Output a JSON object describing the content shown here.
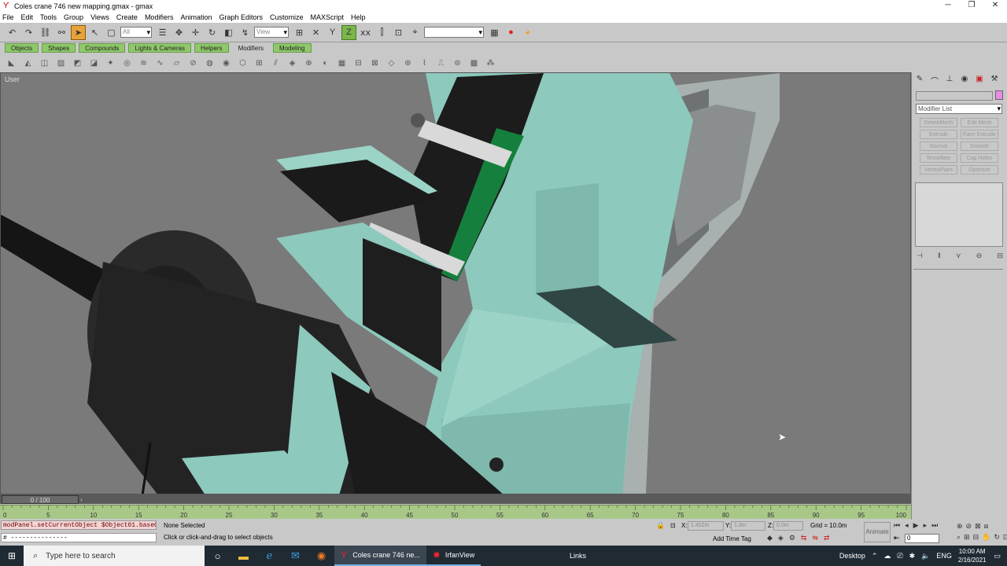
{
  "window": {
    "title": "Coles crane 746 new mapping.gmax - gmax",
    "minimize": "─",
    "maximize": "❐",
    "close": "✕"
  },
  "menu": [
    "File",
    "Edit",
    "Tools",
    "Group",
    "Views",
    "Create",
    "Modifiers",
    "Animation",
    "Graph Editors",
    "Customize",
    "MAXScript",
    "Help"
  ],
  "toolbar": {
    "selection_filter": "All",
    "ref_coord": "View",
    "named_selection": ""
  },
  "tabs": [
    "Objects",
    "Shapes",
    "Compounds",
    "Lights & Cameras",
    "Helpers",
    "Modifiers",
    "Modeling"
  ],
  "selected_tab": "Modifiers",
  "viewport": {
    "label": "User"
  },
  "command_panel": {
    "modifier_list": "Modifier List",
    "modifier_buttons": [
      "DeleteMesh",
      "Edit Mesh",
      "Extrude",
      "Face Extrude",
      "Normal",
      "Smooth",
      "Tessellate",
      "Cap Holes",
      "VertexPaint",
      "Optimize"
    ]
  },
  "timeline": {
    "slider": "0 / 100",
    "ticks": [
      "0",
      "5",
      "10",
      "15",
      "20",
      "25",
      "30",
      "35",
      "40",
      "45",
      "50",
      "55",
      "60",
      "65",
      "70",
      "75",
      "80",
      "85",
      "90",
      "95",
      "100"
    ]
  },
  "status": {
    "maxscript_line1": "modPanel.setCurrentObject $Object01.baseOb",
    "maxscript_line2": "# ---------------",
    "selection": "None Selected",
    "prompt": "Click or click-and-drag to select objects",
    "x_label": "X:",
    "x_value": "1.452m",
    "y_label": "Y:",
    "y_value": "1.3m",
    "z_label": "Z:",
    "z_value": "0.0m",
    "grid": "Grid = 10.0m",
    "add_time_tag": "Add Time Tag",
    "animate": "Animate",
    "frame": "0"
  },
  "taskbar": {
    "search_placeholder": "Type here to search",
    "apps": [
      {
        "label": "Coles crane 746 ne..."
      },
      {
        "label": "IrfanView"
      }
    ],
    "links": "Links",
    "desktop": "Desktop",
    "lang": "ENG",
    "time": "10:00 AM",
    "date": "2/16/2021"
  }
}
